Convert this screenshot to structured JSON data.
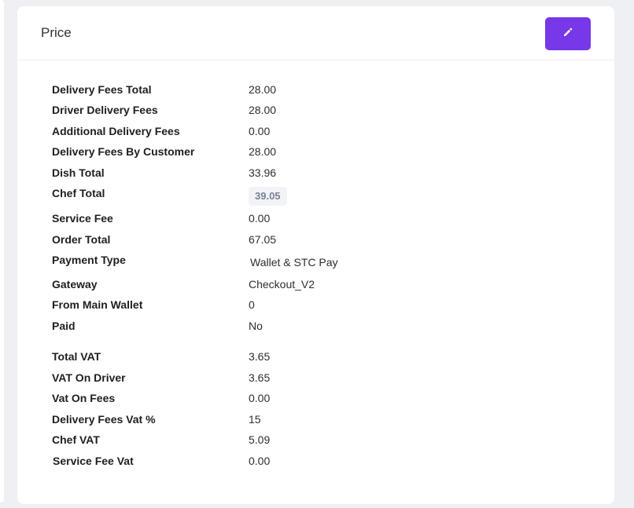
{
  "card": {
    "title": "Price",
    "edit_icon": "pencil-icon"
  },
  "rows": [
    {
      "label": "Delivery Fees Total",
      "value": "28.00"
    },
    {
      "label": "Driver Delivery Fees",
      "value": "28.00"
    },
    {
      "label": "Additional Delivery Fees",
      "value": "0.00"
    },
    {
      "label": "Delivery Fees By Customer",
      "value": "28.00"
    },
    {
      "label": "Dish Total",
      "value": "33.96"
    },
    {
      "label": "Chef Total",
      "value": "39.05"
    },
    {
      "label": "Service Fee",
      "value": "0.00"
    },
    {
      "label": "Order Total",
      "value": "67.05"
    },
    {
      "label": "Payment Type",
      "value": "Wallet & STC Pay"
    },
    {
      "label": "Gateway",
      "value": "Checkout_V2"
    },
    {
      "label": "From Main Wallet",
      "value": "0"
    },
    {
      "label": "Paid",
      "value": "No"
    },
    {
      "label": "Total VAT",
      "value": "3.65"
    },
    {
      "label": "VAT On Driver",
      "value": "3.65"
    },
    {
      "label": "Vat On Fees",
      "value": "0.00"
    },
    {
      "label": "Delivery Fees Vat %",
      "value": "15"
    },
    {
      "label": "Chef VAT",
      "value": "5.09"
    },
    {
      "label": "Service Fee Vat",
      "value": "0.00"
    }
  ],
  "colors": {
    "accent": "#7638e8",
    "badge_bg": "#f1f3f7",
    "badge_text": "#7a8290"
  }
}
